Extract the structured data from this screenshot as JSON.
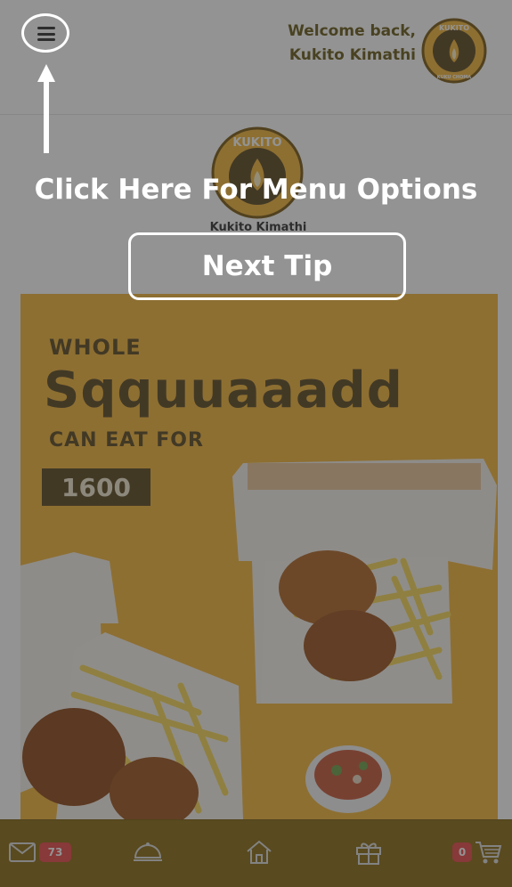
{
  "header": {
    "welcome_line1": "Welcome back,",
    "welcome_line2": "Kukito Kimathi",
    "logo_text_top": "KUKITO",
    "logo_text_bottom": "KUKU CHOMA"
  },
  "center_logo": {
    "logo_text_top": "KUKITO",
    "name": "Kukito Kimathi"
  },
  "banner": {
    "line1": "WHOLE",
    "line2": "Sqquuaaadd",
    "line3": "CAN EAT FOR",
    "price": "1600"
  },
  "bottom_nav": {
    "messages_count": "73",
    "cart_count": "0"
  },
  "tutorial": {
    "tip_text": "Click Here For Menu Options",
    "next_button": "Next Tip"
  },
  "colors": {
    "brand_gold": "#f2b63d",
    "brand_brown": "#5d4a22",
    "nav_bar": "#8a6c16",
    "badge_red": "#e84a4a"
  },
  "icons": [
    "menu-icon",
    "mail-icon",
    "food-tray-icon",
    "home-icon",
    "gift-icon",
    "cart-icon"
  ]
}
